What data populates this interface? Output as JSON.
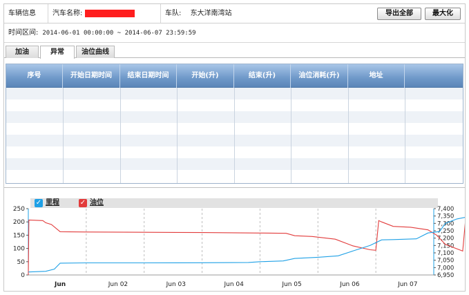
{
  "info": {
    "vehicle_info_label": "车辆信息",
    "car_name_label": "汽车名称:",
    "fleet_label": "车队:",
    "fleet_value": "东大洋南湾站",
    "export_all": "导出全部",
    "maximize": "最大化"
  },
  "time_range": {
    "label": "时间区间:",
    "value": "2014-06-01 00:00:00 ~ 2014-06-07 23:59:59"
  },
  "tabs": [
    {
      "label": "加油",
      "active": false
    },
    {
      "label": "异常",
      "active": true
    },
    {
      "label": "油位曲线",
      "active": false
    }
  ],
  "grid": {
    "columns": [
      "序号",
      "开始日期时间",
      "结束日期时间",
      "开始(升)",
      "结束(升)",
      "油位消耗(升)",
      "地址"
    ]
  },
  "legend": {
    "mileage_label": "里程",
    "fuel_label": "油位",
    "mileage_color": "#1ea0e6",
    "fuel_color": "#e23b3b"
  },
  "chart_data": {
    "type": "line",
    "x_ticks": [
      "Jun",
      "Jun 02",
      "Jun 03",
      "Jun 04",
      "Jun 05",
      "Jun 06",
      "Jun 07"
    ],
    "y_left_ticks": [
      "0",
      "50",
      "100",
      "150",
      "200",
      "250"
    ],
    "y_left_range": [
      0,
      250
    ],
    "y_right_ticks": [
      "6,950",
      "7,000",
      "7,050",
      "7,100",
      "7,150",
      "7,200",
      "7,250",
      "7,300",
      "7,350",
      "7,400"
    ],
    "y_right_range": [
      6950,
      7400
    ],
    "x_range": [
      0,
      7
    ],
    "series": [
      {
        "name": "油位",
        "axis": "left",
        "color": "#e23b3b",
        "points": [
          [
            0.0,
            0
          ],
          [
            0.01,
            207
          ],
          [
            0.25,
            205
          ],
          [
            0.3,
            197
          ],
          [
            0.4,
            190
          ],
          [
            0.55,
            163
          ],
          [
            1.0,
            162
          ],
          [
            2.0,
            161
          ],
          [
            3.0,
            160
          ],
          [
            4.0,
            158
          ],
          [
            4.45,
            157
          ],
          [
            4.6,
            148
          ],
          [
            4.9,
            145
          ],
          [
            5.3,
            135
          ],
          [
            5.6,
            110
          ],
          [
            5.9,
            95
          ],
          [
            6.0,
            93
          ],
          [
            6.05,
            205
          ],
          [
            6.1,
            200
          ],
          [
            6.3,
            183
          ],
          [
            6.6,
            180
          ],
          [
            6.9,
            170
          ],
          [
            7.05,
            150
          ],
          [
            7.2,
            115
          ],
          [
            7.5,
            90
          ],
          [
            7.55,
            212
          ],
          [
            7.62,
            212
          ]
        ]
      },
      {
        "name": "里程",
        "axis": "right",
        "color": "#1ea0e6",
        "points": [
          [
            0.0,
            6970
          ],
          [
            0.3,
            6975
          ],
          [
            0.45,
            6990
          ],
          [
            0.55,
            7030
          ],
          [
            1.0,
            7032
          ],
          [
            2.0,
            7032
          ],
          [
            3.0,
            7033
          ],
          [
            3.8,
            7035
          ],
          [
            4.0,
            7040
          ],
          [
            4.4,
            7045
          ],
          [
            4.6,
            7062
          ],
          [
            5.0,
            7070
          ],
          [
            5.35,
            7080
          ],
          [
            5.6,
            7112
          ],
          [
            5.9,
            7150
          ],
          [
            6.1,
            7188
          ],
          [
            6.3,
            7190
          ],
          [
            6.7,
            7195
          ],
          [
            6.9,
            7235
          ],
          [
            7.1,
            7245
          ],
          [
            7.2,
            7300
          ],
          [
            7.4,
            7330
          ],
          [
            7.6,
            7345
          ]
        ]
      }
    ]
  }
}
